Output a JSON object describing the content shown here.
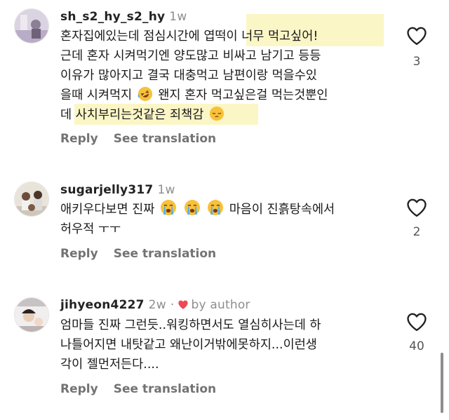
{
  "comments": [
    {
      "username": "sh_s2_hy_s2_hy",
      "time": "1w",
      "by_author": "",
      "lines": [
        "혼자집에있는데 점심시간에 엽떡이 너무 먹고싶어!",
        "근데 혼자 시켜먹기엔 양도많고 비싸고 남기고 등등",
        "이유가 많아지고 결국 대충먹고 남편이랑 먹을수있",
        "을때 시켜먹지",
        "왠지 혼자 먹고싶은걸 먹는것뿐인",
        "데 사치부리는것같은 죄책감"
      ],
      "reply": "Reply",
      "translate": "See translation",
      "likes": "3",
      "avatar_icon": "profile-photo"
    },
    {
      "username": "sugarjelly317",
      "time": "1w",
      "by_author": "",
      "lines": [
        "애키우다보면 진짜",
        "마음이 진흙탕속에서",
        "허우적 ㅜㅜ"
      ],
      "reply": "Reply",
      "translate": "See translation",
      "likes": "2",
      "avatar_icon": "profile-photo"
    },
    {
      "username": "jihyeon4227",
      "time": "2w",
      "by_author": "by author",
      "lines": [
        "엄마들 진짜 그런듯..워킹하면서도 열심히사는데 하",
        "나틀어지면 내탓같고 왜난이거밖에못하지...이런생",
        "각이 젤먼저든다...."
      ],
      "reply": "Reply",
      "translate": "See translation",
      "likes": "40",
      "avatar_icon": "profile-photo"
    }
  ],
  "colors": {
    "heart_red": "#ed4956",
    "highlight": "#fbf6c6",
    "muted": "#8e8e8e"
  },
  "icons": [
    "heart-outline-icon",
    "heart-filled-icon",
    "rofl-emoji",
    "loudly-crying-emoji",
    "pensive-emoji"
  ]
}
